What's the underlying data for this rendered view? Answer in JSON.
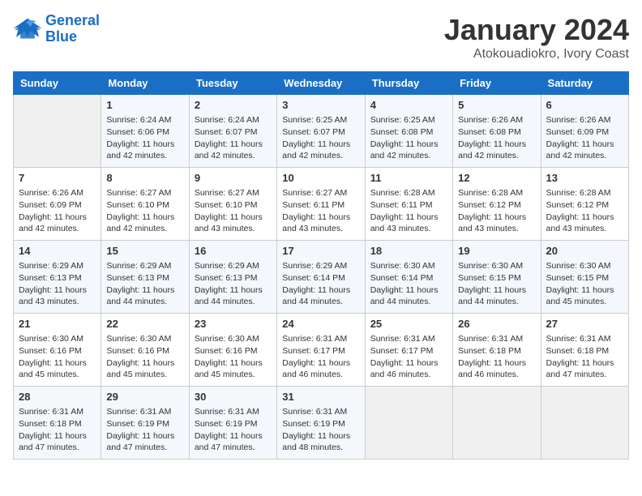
{
  "logo": {
    "line1": "General",
    "line2": "Blue"
  },
  "title": "January 2024",
  "subtitle": "Atokouadiokro, Ivory Coast",
  "weekdays": [
    "Sunday",
    "Monday",
    "Tuesday",
    "Wednesday",
    "Thursday",
    "Friday",
    "Saturday"
  ],
  "weeks": [
    [
      {
        "day": "",
        "info": ""
      },
      {
        "day": "1",
        "info": "Sunrise: 6:24 AM\nSunset: 6:06 PM\nDaylight: 11 hours\nand 42 minutes."
      },
      {
        "day": "2",
        "info": "Sunrise: 6:24 AM\nSunset: 6:07 PM\nDaylight: 11 hours\nand 42 minutes."
      },
      {
        "day": "3",
        "info": "Sunrise: 6:25 AM\nSunset: 6:07 PM\nDaylight: 11 hours\nand 42 minutes."
      },
      {
        "day": "4",
        "info": "Sunrise: 6:25 AM\nSunset: 6:08 PM\nDaylight: 11 hours\nand 42 minutes."
      },
      {
        "day": "5",
        "info": "Sunrise: 6:26 AM\nSunset: 6:08 PM\nDaylight: 11 hours\nand 42 minutes."
      },
      {
        "day": "6",
        "info": "Sunrise: 6:26 AM\nSunset: 6:09 PM\nDaylight: 11 hours\nand 42 minutes."
      }
    ],
    [
      {
        "day": "7",
        "info": "Sunrise: 6:26 AM\nSunset: 6:09 PM\nDaylight: 11 hours\nand 42 minutes."
      },
      {
        "day": "8",
        "info": "Sunrise: 6:27 AM\nSunset: 6:10 PM\nDaylight: 11 hours\nand 42 minutes."
      },
      {
        "day": "9",
        "info": "Sunrise: 6:27 AM\nSunset: 6:10 PM\nDaylight: 11 hours\nand 43 minutes."
      },
      {
        "day": "10",
        "info": "Sunrise: 6:27 AM\nSunset: 6:11 PM\nDaylight: 11 hours\nand 43 minutes."
      },
      {
        "day": "11",
        "info": "Sunrise: 6:28 AM\nSunset: 6:11 PM\nDaylight: 11 hours\nand 43 minutes."
      },
      {
        "day": "12",
        "info": "Sunrise: 6:28 AM\nSunset: 6:12 PM\nDaylight: 11 hours\nand 43 minutes."
      },
      {
        "day": "13",
        "info": "Sunrise: 6:28 AM\nSunset: 6:12 PM\nDaylight: 11 hours\nand 43 minutes."
      }
    ],
    [
      {
        "day": "14",
        "info": "Sunrise: 6:29 AM\nSunset: 6:13 PM\nDaylight: 11 hours\nand 43 minutes."
      },
      {
        "day": "15",
        "info": "Sunrise: 6:29 AM\nSunset: 6:13 PM\nDaylight: 11 hours\nand 44 minutes."
      },
      {
        "day": "16",
        "info": "Sunrise: 6:29 AM\nSunset: 6:13 PM\nDaylight: 11 hours\nand 44 minutes."
      },
      {
        "day": "17",
        "info": "Sunrise: 6:29 AM\nSunset: 6:14 PM\nDaylight: 11 hours\nand 44 minutes."
      },
      {
        "day": "18",
        "info": "Sunrise: 6:30 AM\nSunset: 6:14 PM\nDaylight: 11 hours\nand 44 minutes."
      },
      {
        "day": "19",
        "info": "Sunrise: 6:30 AM\nSunset: 6:15 PM\nDaylight: 11 hours\nand 44 minutes."
      },
      {
        "day": "20",
        "info": "Sunrise: 6:30 AM\nSunset: 6:15 PM\nDaylight: 11 hours\nand 45 minutes."
      }
    ],
    [
      {
        "day": "21",
        "info": "Sunrise: 6:30 AM\nSunset: 6:16 PM\nDaylight: 11 hours\nand 45 minutes."
      },
      {
        "day": "22",
        "info": "Sunrise: 6:30 AM\nSunset: 6:16 PM\nDaylight: 11 hours\nand 45 minutes."
      },
      {
        "day": "23",
        "info": "Sunrise: 6:30 AM\nSunset: 6:16 PM\nDaylight: 11 hours\nand 45 minutes."
      },
      {
        "day": "24",
        "info": "Sunrise: 6:31 AM\nSunset: 6:17 PM\nDaylight: 11 hours\nand 46 minutes."
      },
      {
        "day": "25",
        "info": "Sunrise: 6:31 AM\nSunset: 6:17 PM\nDaylight: 11 hours\nand 46 minutes."
      },
      {
        "day": "26",
        "info": "Sunrise: 6:31 AM\nSunset: 6:18 PM\nDaylight: 11 hours\nand 46 minutes."
      },
      {
        "day": "27",
        "info": "Sunrise: 6:31 AM\nSunset: 6:18 PM\nDaylight: 11 hours\nand 47 minutes."
      }
    ],
    [
      {
        "day": "28",
        "info": "Sunrise: 6:31 AM\nSunset: 6:18 PM\nDaylight: 11 hours\nand 47 minutes."
      },
      {
        "day": "29",
        "info": "Sunrise: 6:31 AM\nSunset: 6:19 PM\nDaylight: 11 hours\nand 47 minutes."
      },
      {
        "day": "30",
        "info": "Sunrise: 6:31 AM\nSunset: 6:19 PM\nDaylight: 11 hours\nand 47 minutes."
      },
      {
        "day": "31",
        "info": "Sunrise: 6:31 AM\nSunset: 6:19 PM\nDaylight: 11 hours\nand 48 minutes."
      },
      {
        "day": "",
        "info": ""
      },
      {
        "day": "",
        "info": ""
      },
      {
        "day": "",
        "info": ""
      }
    ]
  ]
}
